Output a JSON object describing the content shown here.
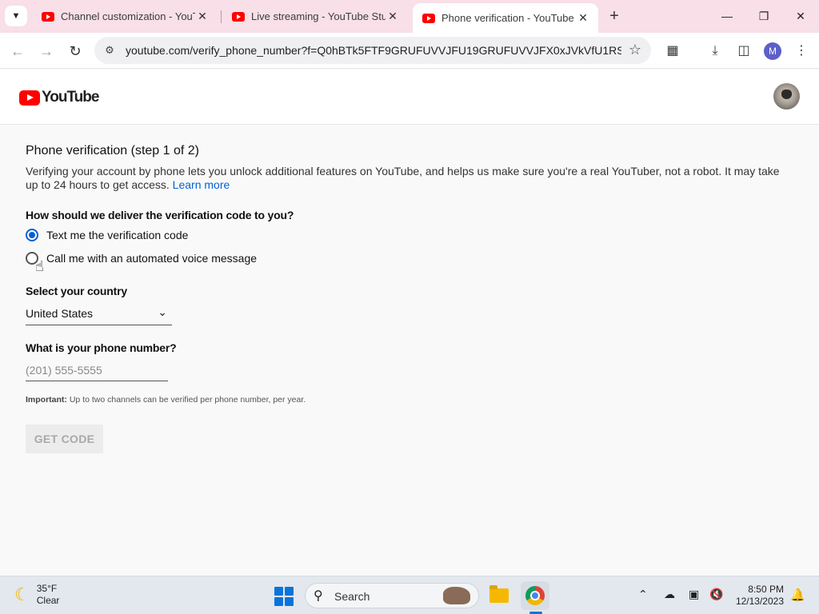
{
  "browser": {
    "tabs": [
      {
        "title": "Channel customization - YouTube",
        "active": false
      },
      {
        "title": "Live streaming - YouTube Studio",
        "active": false
      },
      {
        "title": "Phone verification - YouTube",
        "active": true
      }
    ],
    "address": "youtube.com/verify_phone_number?f=Q0hBTk5FTF9GRUFUVVJFU19GRUFUVVJFX0xJVkVfU1RSRUF...",
    "profile_initial": "M"
  },
  "youtube": {
    "logo_text": "YouTube"
  },
  "verification": {
    "title": "Phone verification (step 1 of 2)",
    "description": "Verifying your account by phone lets you unlock additional features on YouTube, and helps us make sure you're a real YouTuber, not a robot. It may take up to 24 hours to get access.",
    "learn_more": "Learn more",
    "delivery_question": "How should we deliver the verification code to you?",
    "options": [
      {
        "label": "Text me the verification code",
        "selected": true
      },
      {
        "label": "Call me with an automated voice message",
        "selected": false
      }
    ],
    "country_label": "Select your country",
    "country_value": "United States",
    "phone_label": "What is your phone number?",
    "phone_placeholder": "(201) 555-5555",
    "note_bold": "Important:",
    "note_text": " Up to two channels can be verified per phone number, per year.",
    "button": "GET CODE"
  },
  "taskbar": {
    "temperature": "35°F",
    "condition": "Clear",
    "search_label": "Search",
    "time": "8:50 PM",
    "date": "12/13/2023"
  },
  "colors": {
    "accent": "#065fd4",
    "youtube_red": "#ff0000",
    "tabbar": "#f8dfe8"
  }
}
